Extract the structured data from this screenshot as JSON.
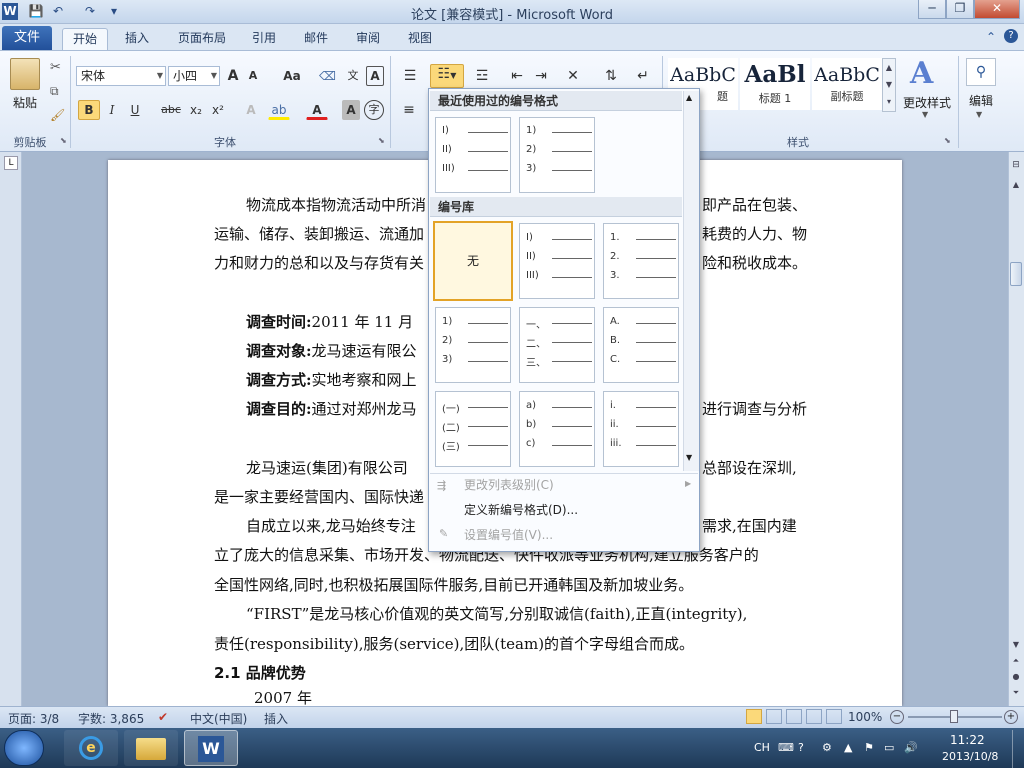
{
  "window": {
    "title": "论文 [兼容模式] - Microsoft Word",
    "app_icon": "W"
  },
  "quick_access": {
    "save_icon": "save-icon",
    "undo_icon": "undo-icon",
    "redo_icon": "redo-icon"
  },
  "tabs": [
    "文件",
    "开始",
    "插入",
    "页面布局",
    "引用",
    "邮件",
    "审阅",
    "视图"
  ],
  "ribbon": {
    "clipboard": {
      "paste_label": "粘贴",
      "group_label": "剪贴板"
    },
    "font": {
      "font_name": "宋体",
      "font_size": "小四",
      "group_label": "字体",
      "bold": "B",
      "italic": "I",
      "underline": "U",
      "strike": "abc",
      "sub": "x₂",
      "sup": "x²",
      "aa": "Aa",
      "grow": "A",
      "shrink": "A",
      "font_color": "A",
      "char_border": "A",
      "char_shade": "A",
      "enclose": "字"
    },
    "styles": {
      "group_label": "样式",
      "items": [
        {
          "sample": "AaBbC",
          "name": "题"
        },
        {
          "sample": "AaBl",
          "name": "标题 1"
        },
        {
          "sample": "AaBbC",
          "name": "副标题"
        }
      ],
      "change_styles": "更改样式"
    },
    "editing": {
      "label": "编辑"
    }
  },
  "numbering_dropdown": {
    "recent_header": "最近使用过的编号格式",
    "library_header": "编号库",
    "recent": [
      [
        "I)",
        "II)",
        "III)"
      ],
      [
        "1)",
        "2)",
        "3)"
      ]
    ],
    "library": [
      {
        "none": "无"
      },
      [
        "I)",
        "II)",
        "III)"
      ],
      [
        "1.",
        "2.",
        "3."
      ],
      [
        "1)",
        "2)",
        "3)"
      ],
      [
        "一、",
        "二、",
        "三、"
      ],
      [
        "A.",
        "B.",
        "C."
      ],
      [
        "(一)",
        "(二)",
        "(三)"
      ],
      [
        "a)",
        "b)",
        "c)"
      ],
      [
        "i.",
        "ii.",
        "iii."
      ]
    ],
    "menu": [
      {
        "label": "更改列表级别(C)",
        "enabled": false
      },
      {
        "label": "定义新编号格式(D)...",
        "enabled": true
      },
      {
        "label": "设置编号值(V)...",
        "enabled": false
      }
    ]
  },
  "document": {
    "lines": [
      {
        "a": "物流成本指物流活动中所消",
        "b": "即产品在包装、"
      },
      {
        "a": "运输、储存、装卸搬运、流通加",
        "b": "耗费的人力、物"
      },
      {
        "a": "力和财力的总和以及与存货有关",
        "b": "险和税收成本。"
      },
      {
        "bold": "调查时间:",
        "text": "2011 年 11 月"
      },
      {
        "bold": "调查对象:",
        "text": "龙马速运有限公"
      },
      {
        "bold": "调查方式:",
        "text": "实地考察和网上"
      },
      {
        "bold": "调查目的:",
        "text": "通过对郑州龙马",
        "tail": "进行调查与分析"
      },
      {
        "a": "龙马速运(集团)有限公司",
        "b": "总部设在深圳,"
      },
      {
        "a": "是一家主要经营国内、国际快递"
      },
      {
        "a": "自成立以来,龙马始终专注",
        "b": "需求,在国内建"
      },
      {
        "a": "立了庞大的信息采集、市场开发、物流配送、快件收派等业务机构,建立服务客户的"
      },
      {
        "a": "全国性网络,同时,也积极拓展国际件服务,目前已开通韩国及新加坡业务。"
      },
      {
        "a": "“FIRST”是龙马核心价值观的英文简写,分别取诚信(faith),正直(integrity),"
      },
      {
        "a": "责任(responsibility),服务(service),团队(team)的首个字母组合而成。"
      },
      {
        "heading": "2.1  品牌优势"
      },
      {
        "a": "2007 年"
      }
    ]
  },
  "statusbar": {
    "page": "页面: 3/8",
    "words": "字数: 3,865",
    "lang": "中文(中国)",
    "mode": "插入",
    "zoom": "100%"
  },
  "taskbar": {
    "ime": "CH",
    "time": "11:22",
    "date": "2013/10/8"
  }
}
